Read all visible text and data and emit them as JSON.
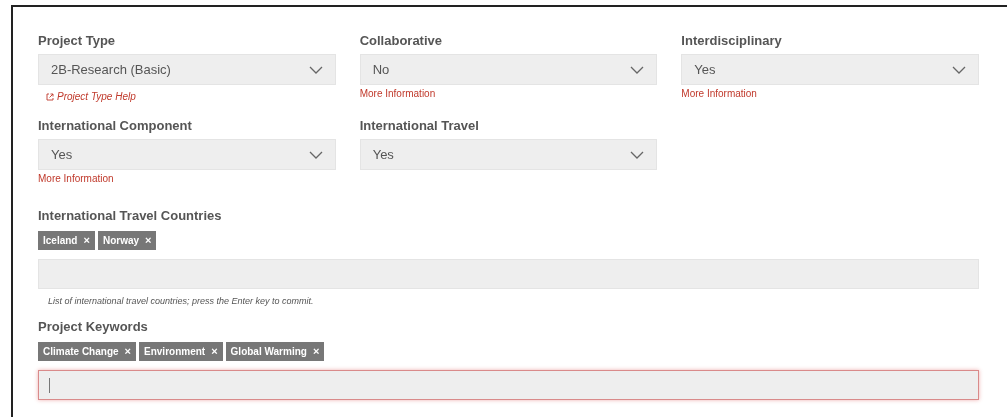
{
  "selects": [
    {
      "label": "Project Type",
      "value": "2B-Research (Basic)",
      "help": {
        "kind": "external",
        "text": "Project Type Help"
      }
    },
    {
      "label": "Collaborative",
      "value": "No",
      "help": {
        "kind": "plain",
        "text": "More Information"
      }
    },
    {
      "label": "Interdisciplinary",
      "value": "Yes",
      "help": {
        "kind": "plain",
        "text": "More Information"
      }
    },
    {
      "label": "International Component",
      "value": "Yes",
      "help": {
        "kind": "plain",
        "text": "More Information"
      }
    },
    {
      "label": "International Travel",
      "value": "Yes"
    }
  ],
  "tag_fields": [
    {
      "label": "International Travel Countries",
      "tags": [
        {
          "text": "Iceland",
          "remove": "×"
        },
        {
          "text": "Norway",
          "remove": "×"
        }
      ],
      "focused": false,
      "hint": "List of international travel countries; press the Enter key to commit."
    },
    {
      "label": "Project Keywords",
      "tags": [
        {
          "text": "Climate Change",
          "remove": "×"
        },
        {
          "text": "Environment",
          "remove": "×"
        },
        {
          "text": "Global Warming",
          "remove": "×"
        }
      ],
      "focused": true
    }
  ]
}
